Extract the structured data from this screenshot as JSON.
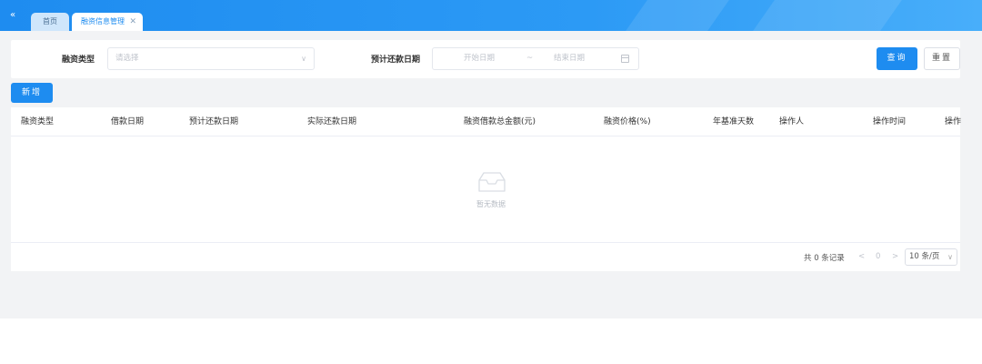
{
  "tabs": {
    "collapse_icon": "double-chevron-left-icon",
    "collapse_glyph": "«",
    "home_label": "首页",
    "active_label": "融资信息管理",
    "close_glyph": "✕"
  },
  "filter": {
    "type_label": "融资类型",
    "type_placeholder": "请选择",
    "chevron_glyph": "∨",
    "date_label": "预计还款日期",
    "start_placeholder": "开始日期",
    "range_separator": "~",
    "end_placeholder": "结束日期",
    "query_label": "查询",
    "reset_label": "重置"
  },
  "toolbar": {
    "add_label": "新增"
  },
  "table": {
    "columns": [
      "融资类型",
      "借款日期",
      "预计还款日期",
      "实际还款日期",
      "融资借款总金额(元)",
      "融资价格(%)",
      "年基准天数",
      "操作人",
      "操作时间",
      "操作"
    ],
    "empty_text": "暂无数据"
  },
  "pagination": {
    "total_text": "共 0 条记录",
    "prev_glyph": "<",
    "current_page": "0",
    "next_glyph": ">",
    "page_size": "10 条/页",
    "chevron_glyph": "∨"
  },
  "colors": {
    "primary": "#1e8cf0",
    "background": "#f2f3f5",
    "border": "#ebeef5",
    "placeholder": "#c0c4cc"
  }
}
